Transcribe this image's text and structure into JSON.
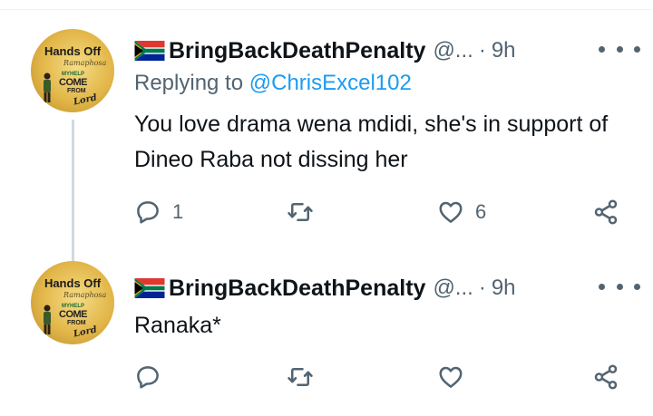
{
  "tweets": [
    {
      "avatar": {
        "title": "Hands Off",
        "script": "Ramaphosa",
        "help": "MYHELP",
        "come": "COME",
        "from": "FROM",
        "lord": "Lord"
      },
      "display_name": "BringBackDeathPenalty",
      "handle": "@...",
      "separator": "·",
      "time": "9h",
      "reply_prefix": "Replying to",
      "reply_to": "@ChrisExcel102",
      "text": "You love drama wena mdidi, she's in support of Dineo Raba not dissing her",
      "counts": {
        "replies": "1",
        "retweets": "",
        "likes": "6"
      }
    },
    {
      "avatar": {
        "title": "Hands Off",
        "script": "Ramaphosa",
        "help": "MYHELP",
        "come": "COME",
        "from": "FROM",
        "lord": "Lord"
      },
      "display_name": "BringBackDeathPenalty",
      "handle": "@...",
      "separator": "·",
      "time": "9h",
      "text": "Ranaka*",
      "counts": {
        "replies": "",
        "retweets": "",
        "likes": ""
      }
    }
  ],
  "icons": {
    "flag": "south-africa-flag-icon",
    "more": "more-dots-icon",
    "reply": "reply-icon",
    "retweet": "retweet-icon",
    "like": "heart-icon",
    "share": "share-icon"
  },
  "colors": {
    "text": "#0f1419",
    "secondary": "#536471",
    "link": "#1d9bf0",
    "thread_line": "#cfd9de"
  }
}
